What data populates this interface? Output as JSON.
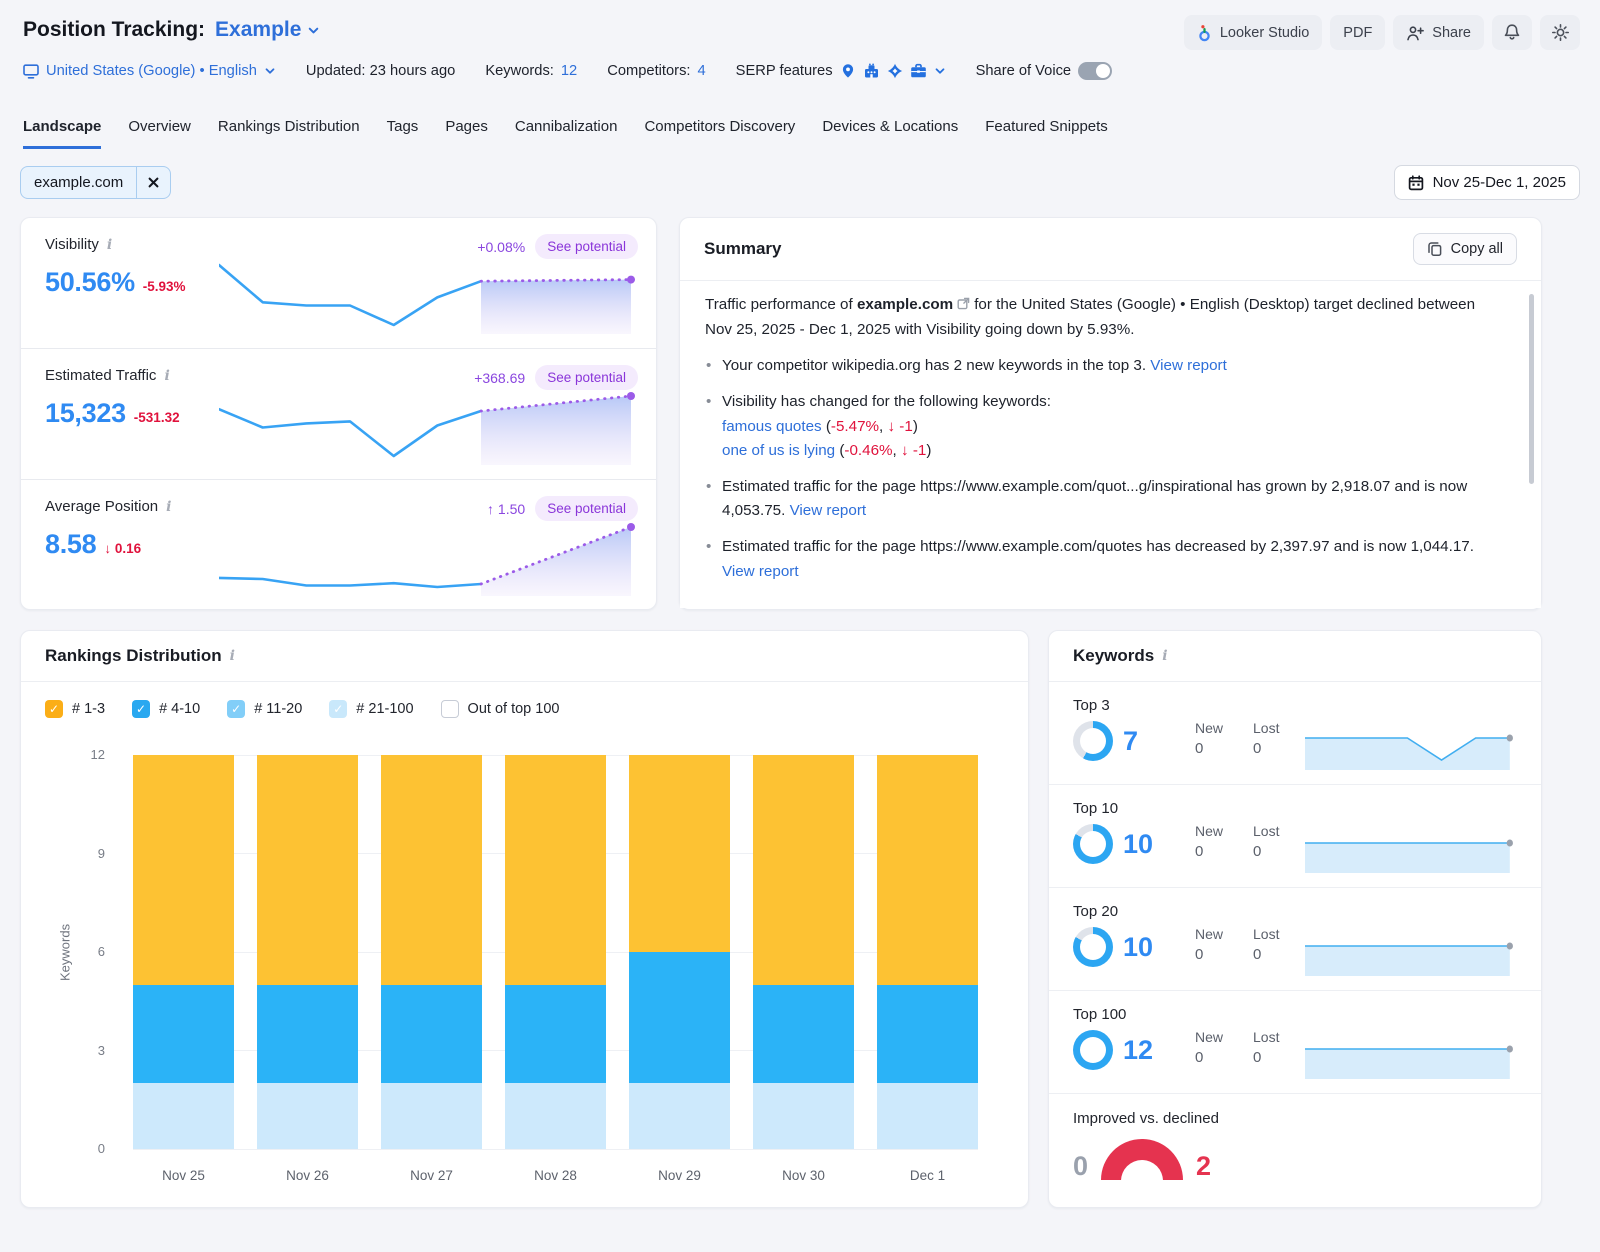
{
  "header": {
    "title": "Position Tracking:",
    "project": "Example",
    "buttons": {
      "looker": "Looker Studio",
      "pdf": "PDF",
      "share": "Share"
    },
    "meta": {
      "target": "United States (Google) • English",
      "updated": "Updated: 23 hours ago",
      "keywords_label": "Keywords:",
      "keywords_value": "12",
      "competitors_label": "Competitors:",
      "competitors_value": "4",
      "serp_label": "SERP features",
      "sov_label": "Share of Voice"
    },
    "tabs": [
      {
        "label": "Landscape",
        "active": true
      },
      {
        "label": "Overview",
        "active": false
      },
      {
        "label": "Rankings Distribution",
        "active": false
      },
      {
        "label": "Tags",
        "active": false
      },
      {
        "label": "Pages",
        "active": false
      },
      {
        "label": "Cannibalization",
        "active": false
      },
      {
        "label": "Competitors Discovery",
        "active": false
      },
      {
        "label": "Devices & Locations",
        "active": false
      },
      {
        "label": "Featured Snippets",
        "active": false
      }
    ],
    "icons": [
      "looker-studio-icon",
      "share-person-plus-icon",
      "bell-icon",
      "gear-icon",
      "monitor-icon",
      "location-pin-icon",
      "hotel-icon",
      "instant-answer-icon",
      "jobs-icon",
      "chevron-down-icon"
    ]
  },
  "filters": {
    "chip": "example.com",
    "date_range": "Nov 25-Dec 1, 2025"
  },
  "colors": {
    "accent_blue": "#2e6fd9",
    "metric_blue": "#2f8af2",
    "negative_red": "#e0123c",
    "potential_purple": "#8a46df",
    "spark_blue": "#38a3f4",
    "declined_red": "#e5334f"
  },
  "metrics": {
    "visibility": {
      "label": "Visibility",
      "value": "50.56%",
      "delta": "-5.93%",
      "potential": "+0.08%",
      "pill": "See potential"
    },
    "traffic": {
      "label": "Estimated Traffic",
      "value": "15,323",
      "delta": "-531.32",
      "potential": "+368.69",
      "pill": "See potential"
    },
    "position": {
      "label": "Average Position",
      "value": "8.58",
      "delta": "↓ 0.16",
      "potential": "↑ 1.50",
      "pill": "See potential"
    }
  },
  "summary": {
    "title": "Summary",
    "copy_all": "Copy all",
    "intro_pre": "Traffic performance of ",
    "intro_domain": "example.com",
    "intro_post": "for the United States (Google) • English (Desktop) target declined between Nov 25, 2025 - Dec 1, 2025 with Visibility going down by 5.93%.",
    "bullets": [
      {
        "segments": [
          {
            "t": "Your competitor wikipedia.org has 2 new keywords in the top 3. "
          },
          {
            "t": "View report",
            "s": "link"
          }
        ]
      },
      {
        "segments": [
          {
            "t": "Visibility has changed for the following keywords:"
          },
          {
            "br": true
          },
          {
            "t": "famous quotes",
            "s": "link"
          },
          {
            "t": " ("
          },
          {
            "t": "-5.47%",
            "s": "red"
          },
          {
            "t": ", "
          },
          {
            "t": "↓ -1",
            "s": "red"
          },
          {
            "t": ")"
          },
          {
            "br": true
          },
          {
            "t": "one of us is lying",
            "s": "link"
          },
          {
            "t": " ("
          },
          {
            "t": "-0.46%",
            "s": "red"
          },
          {
            "t": ", "
          },
          {
            "t": "↓ -1",
            "s": "red"
          },
          {
            "t": ")"
          }
        ]
      },
      {
        "segments": [
          {
            "t": "Estimated traffic for the page https://www.example.com/quot...g/inspirational has grown by 2,918.07 and is now 4,053.75. "
          },
          {
            "t": "View report",
            "s": "link"
          }
        ]
      },
      {
        "segments": [
          {
            "t": "Estimated traffic for the page https://www.example.com/quotes has decreased by 2,397.97 and is now 1,044.17. "
          },
          {
            "t": "View report",
            "s": "link"
          }
        ]
      }
    ]
  },
  "rankings": {
    "title": "Rankings Distribution",
    "filters": [
      {
        "label": "# 1-3",
        "color": "#fbae17",
        "checked": true
      },
      {
        "label": "# 4-10",
        "color": "#29a8f0",
        "checked": true
      },
      {
        "label": "# 11-20",
        "color": "#82cef8",
        "checked": true
      },
      {
        "label": "# 21-100",
        "color": "#c9e8fb",
        "checked": true
      },
      {
        "label": "Out of top 100",
        "color": null,
        "checked": false
      }
    ]
  },
  "keywords_card": {
    "title": "Keywords",
    "new_label": "New",
    "lost_label": "Lost",
    "rows": [
      {
        "title": "Top 3",
        "value": "7",
        "fraction": 0.583,
        "new": "0",
        "lost": "0",
        "trend": [
          7,
          7,
          7,
          7,
          6,
          7,
          7
        ]
      },
      {
        "title": "Top 10",
        "value": "10",
        "fraction": 0.833,
        "new": "0",
        "lost": "0",
        "trend": [
          10,
          10,
          10,
          10,
          10,
          10,
          10
        ]
      },
      {
        "title": "Top 20",
        "value": "10",
        "fraction": 0.833,
        "new": "0",
        "lost": "0",
        "trend": [
          10,
          10,
          10,
          10,
          10,
          10,
          10
        ]
      },
      {
        "title": "Top 100",
        "value": "12",
        "fraction": 1.0,
        "new": "0",
        "lost": "0",
        "trend": [
          12,
          12,
          12,
          12,
          12,
          12,
          12
        ]
      }
    ],
    "improved": {
      "label": "Improved vs. declined",
      "improved": "0",
      "declined": "2"
    }
  },
  "chart_data": [
    {
      "id": "rankings_distribution",
      "type": "bar",
      "stacked": true,
      "title": "Rankings Distribution",
      "categories": [
        "Nov 25",
        "Nov 26",
        "Nov 27",
        "Nov 28",
        "Nov 29",
        "Nov 30",
        "Dec 1"
      ],
      "series": [
        {
          "name": "# 21-100",
          "color": "#cde9fc",
          "values": [
            2,
            2,
            2,
            2,
            2,
            2,
            2
          ]
        },
        {
          "name": "# 11-20",
          "color": "#8fd3fa",
          "values": [
            0,
            0,
            0,
            0,
            0,
            0,
            0
          ]
        },
        {
          "name": "# 4-10",
          "color": "#2bb3f7",
          "values": [
            3,
            3,
            3,
            3,
            4,
            3,
            3
          ]
        },
        {
          "name": "# 1-3",
          "color": "#fdc233",
          "values": [
            7,
            7,
            7,
            7,
            6,
            7,
            7
          ]
        }
      ],
      "xlabel": "",
      "ylabel": "Keywords",
      "yticks": [
        0,
        3,
        6,
        9,
        12
      ],
      "ylim": [
        0,
        12
      ],
      "grid": true,
      "legend_position": "filters-above"
    },
    {
      "id": "visibility_trend",
      "type": "line",
      "x": [
        "Nov 25",
        "Nov 26",
        "Nov 27",
        "Nov 28",
        "Nov 29",
        "Nov 30",
        "Dec 1"
      ],
      "values": [
        53.4,
        51.1,
        50.9,
        50.9,
        49.7,
        51.4,
        52.4
      ],
      "projection": [
        52.4,
        52.5
      ],
      "invert": false
    },
    {
      "id": "traffic_trend",
      "type": "line",
      "x": [
        "Nov 25",
        "Nov 26",
        "Nov 27",
        "Nov 28",
        "Nov 29",
        "Nov 30",
        "Dec 1"
      ],
      "values": [
        15900,
        15450,
        15550,
        15600,
        14750,
        15500,
        15854
      ],
      "projection": [
        15854,
        16223
      ],
      "invert": false
    },
    {
      "id": "position_trend",
      "type": "line",
      "x": [
        "Nov 25",
        "Nov 26",
        "Nov 27",
        "Nov 28",
        "Nov 29",
        "Nov 30",
        "Dec 1"
      ],
      "values": [
        8.42,
        8.45,
        8.62,
        8.62,
        8.56,
        8.66,
        8.58
      ],
      "projection": [
        8.58,
        7.08
      ],
      "invert": true
    }
  ]
}
